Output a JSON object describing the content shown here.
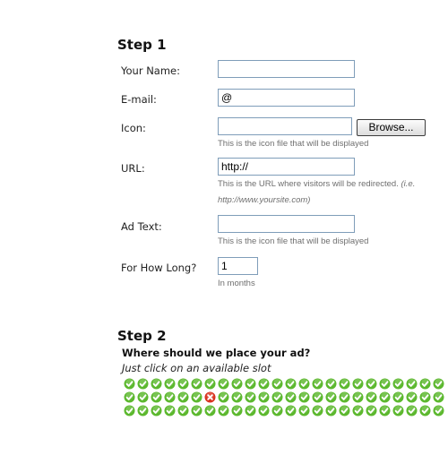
{
  "step1": {
    "title": "Step 1",
    "name_label": "Your Name:",
    "name_value": "",
    "email_label": "E-mail:",
    "email_value": "@",
    "icon_label": "Icon:",
    "icon_value": "",
    "browse_label": "Browse...",
    "icon_hint": "This is the icon file that will be displayed",
    "url_label": "URL:",
    "url_value": "http://",
    "url_hint_prefix": "This is the URL where visitors will be redirected. ",
    "url_hint_example": "(i.e.",
    "url_hint_example_2": "http://www.yoursite.com)",
    "adtext_label": "Ad Text:",
    "adtext_value": "",
    "adtext_hint": "This is the icon file that will be displayed",
    "duration_label": "For How Long?",
    "duration_value": "1",
    "duration_hint": "In months"
  },
  "step2": {
    "title": "Step 2",
    "question": "Where should we place your ad?",
    "instruction": "Just click on an available slot",
    "slot_rows": [
      [
        "available",
        "available",
        "available",
        "available",
        "available",
        "available",
        "available",
        "available",
        "available",
        "available",
        "available",
        "available",
        "available",
        "available",
        "available",
        "available",
        "available",
        "available",
        "available",
        "available",
        "available",
        "available",
        "available",
        "available"
      ],
      [
        "available",
        "available",
        "available",
        "available",
        "available",
        "available",
        "taken",
        "available",
        "available",
        "available",
        "available",
        "available",
        "available",
        "available",
        "available",
        "available",
        "available",
        "available",
        "available",
        "available",
        "available",
        "available",
        "available",
        "available"
      ],
      [
        "available",
        "available",
        "available",
        "available",
        "available",
        "available",
        "available",
        "available",
        "available",
        "available",
        "available",
        "available",
        "available",
        "available",
        "available",
        "available",
        "available",
        "available",
        "available",
        "available",
        "available",
        "available",
        "available",
        "available"
      ]
    ]
  },
  "colors": {
    "available": "#5cb82e",
    "taken": "#d9321f",
    "input_border": "#7f9db9"
  },
  "icons": {
    "available": "check-circle-icon",
    "taken": "x-circle-icon"
  }
}
